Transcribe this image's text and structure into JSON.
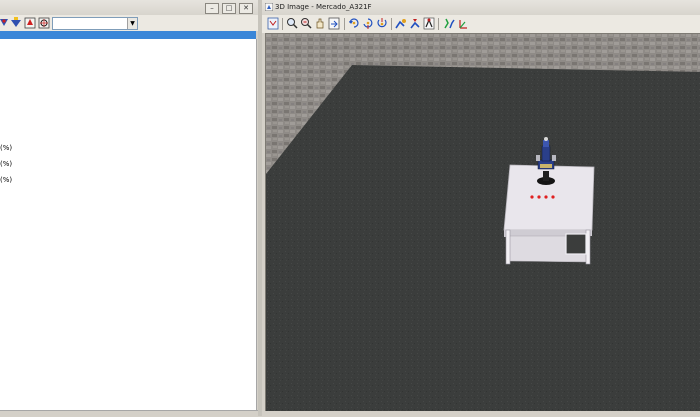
{
  "left_panel": {
    "window_buttons": [
      "–",
      "□",
      "✕"
    ],
    "tree_select_value": "",
    "tree_items": [
      "(%)",
      "(%)",
      "(%)"
    ]
  },
  "viewer": {
    "title": "3D Image - Mercado_A321F",
    "window_buttons": [
      "–",
      "□",
      "✕"
    ],
    "toolbar_icons": [
      "fit-view-icon",
      "zoom-icon",
      "zoom-window-icon",
      "pan-icon",
      "export-icon",
      "rotate-x-icon",
      "rotate-y-icon",
      "rotate-z-icon",
      "robot-view-icon",
      "robot-move-icon",
      "gripper-icon",
      "joint-icon",
      "axis-icon"
    ]
  },
  "colors": {
    "selection": "#3a86d8",
    "floor": "#3b3d3c",
    "paving": "#8e8a86",
    "table": "#e8e6ea",
    "leds": "#e02020",
    "robot": "#2a3f8a"
  }
}
